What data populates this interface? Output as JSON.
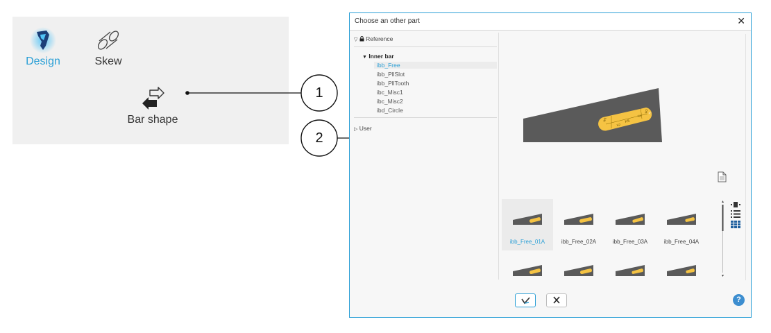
{
  "toolbar": {
    "design_label": "Design",
    "skew_label": "Skew",
    "bar_shape_label": "Bar shape"
  },
  "callouts": [
    "1",
    "2"
  ],
  "dialog": {
    "title": "Choose an other part",
    "tree": {
      "reference_label": "Reference",
      "group_label": "Inner bar",
      "items": [
        "ibb_Free",
        "ibb_PllSlot",
        "ibb_PllTooth",
        "ibc_Misc1",
        "ibc_Misc2",
        "ibd_Circle"
      ],
      "selected": "ibb_Free",
      "user_label": "User"
    },
    "thumbnails": [
      "ibb_Free_01A",
      "ibb_Free_02A",
      "ibb_Free_03A",
      "ibb_Free_04A"
    ],
    "selected_thumbnail": "ibb_Free_01A",
    "icons": {
      "close": "close-icon",
      "document": "document-icon",
      "view_single": "view-single-icon",
      "view_list": "view-list-icon",
      "view_grid": "view-grid-icon",
      "ok": "checkmark-icon",
      "cancel": "cross-icon",
      "help": "help-icon"
    },
    "help_glyph": "?"
  },
  "colors": {
    "accent": "#2a9fd6",
    "magnet_gray": "#555555",
    "bar_yellow": "#f5c343"
  }
}
